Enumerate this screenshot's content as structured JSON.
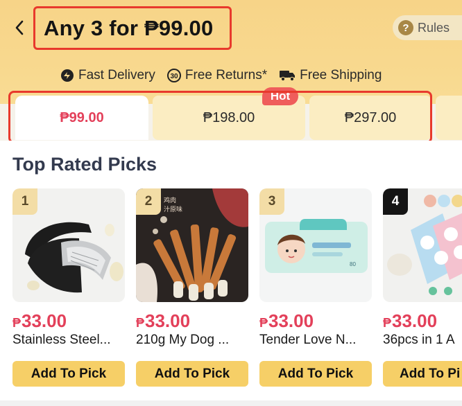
{
  "header": {
    "title": "Any 3 for ₱99.00",
    "rules_label": "Rules",
    "rules_icon": "?",
    "benefits": [
      {
        "label": "Fast Delivery",
        "icon": "fast-delivery-icon"
      },
      {
        "label": "Free Returns*",
        "icon": "free-returns-30-icon",
        "badge": "30"
      },
      {
        "label": "Free Shipping",
        "icon": "free-shipping-truck-icon"
      }
    ]
  },
  "tabs": [
    {
      "label": "₱99.00",
      "selected": true
    },
    {
      "label": "₱198.00",
      "selected": false,
      "badge": "Hot"
    },
    {
      "label": "₱297.00",
      "selected": false
    }
  ],
  "section": {
    "title": "Top Rated Picks"
  },
  "products": [
    {
      "rank": "1",
      "currency": "₱",
      "price": "33.00",
      "name": "Stainless Steel...",
      "button": "Add To Pick"
    },
    {
      "rank": "2",
      "currency": "₱",
      "price": "33.00",
      "name": "210g My Dog ...",
      "button": "Add To Pick"
    },
    {
      "rank": "3",
      "currency": "₱",
      "price": "33.00",
      "name": "Tender Love N...",
      "button": "Add To Pick"
    },
    {
      "rank": "4",
      "currency": "₱",
      "price": "33.00",
      "name": "36pcs in 1 A",
      "button": "Add To Pi"
    }
  ],
  "colors": {
    "header_bg": "#f7d488",
    "highlight_border": "#e8392c",
    "price": "#e3405a",
    "button": "#f6cf67",
    "hot_badge": "#ef5d5b"
  }
}
